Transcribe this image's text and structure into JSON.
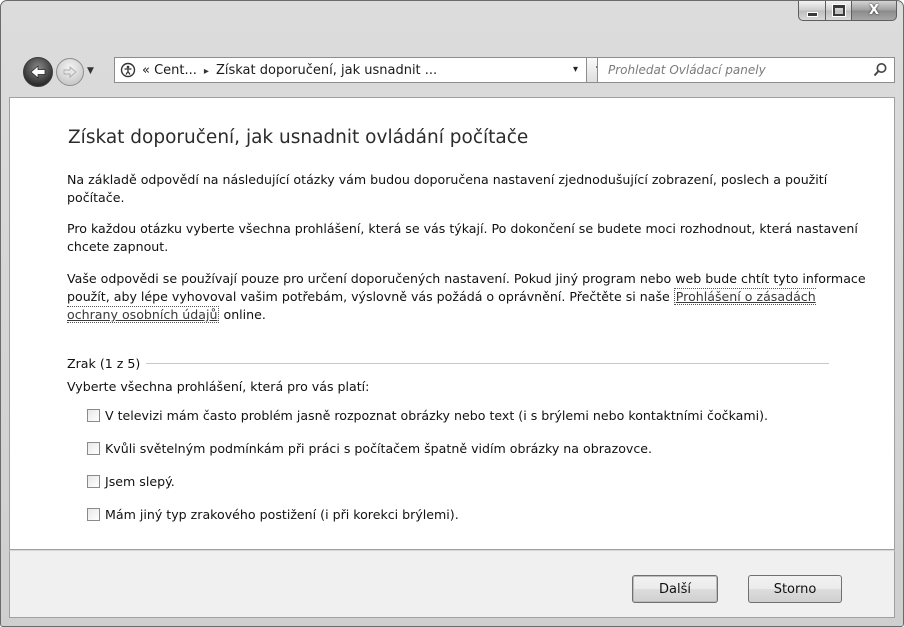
{
  "window": {
    "controls": {
      "minimize_icon": "minimize-icon",
      "maximize_icon": "maximize-icon",
      "close_icon": "close-icon",
      "close_glyph": "X"
    }
  },
  "navigation": {
    "back_icon": "back-arrow-icon",
    "forward_icon": "forward-arrow-icon",
    "history_dropdown_icon": "chevron-down-icon",
    "address": {
      "icon": "ease-of-access-icon",
      "crumb_prefix": "«",
      "crumbs": [
        "Cent...",
        "Získat doporučení, jak usnadnit ..."
      ],
      "separator": "▸",
      "dropdown_glyph": "▾"
    },
    "refresh_glyph": "⁴↲",
    "search": {
      "placeholder": "Prohledat Ovládací panely",
      "icon": "search-icon"
    }
  },
  "page": {
    "title": "Získat doporučení, jak usnadnit ovládání počítače",
    "para1": "Na základě odpovědí na následující otázky vám budou doporučena nastavení zjednodušující zobrazení, poslech a použití počítače.",
    "para2": "Pro každou otázku vyberte všechna prohlášení, která se vás týkají. Po dokončení se budete moci rozhodnout, která nastavení chcete zapnout.",
    "para3_before": "Vaše odpovědi se používají pouze pro určení doporučených nastavení. Pokud jiný program nebo web bude chtít tyto informace použít, aby lépe vyhovoval vašim potřebám, výslovně vás požádá o oprávnění. Přečtěte si naše ",
    "para3_link": "Prohlášení o zásadách ochrany osobních údajů",
    "para3_after": " online.",
    "section_label": "Zrak (1 z 5)",
    "instruction": "Vyberte všechna prohlášení, která pro vás platí:",
    "checkboxes": [
      {
        "label": "V televizi mám často problém jasně rozpoznat obrázky nebo text (i s brýlemi nebo kontaktními čočkami).",
        "checked": false
      },
      {
        "label": "Kvůli světelným podmínkám při práci s počítačem špatně vidím obrázky na obrazovce.",
        "checked": false
      },
      {
        "label": "Jsem slepý.",
        "checked": false
      },
      {
        "label": "Mám jiný typ zrakového postižení (i při korekci brýlemi).",
        "checked": false
      }
    ]
  },
  "footer": {
    "next_label": "Další",
    "cancel_label": "Storno"
  }
}
